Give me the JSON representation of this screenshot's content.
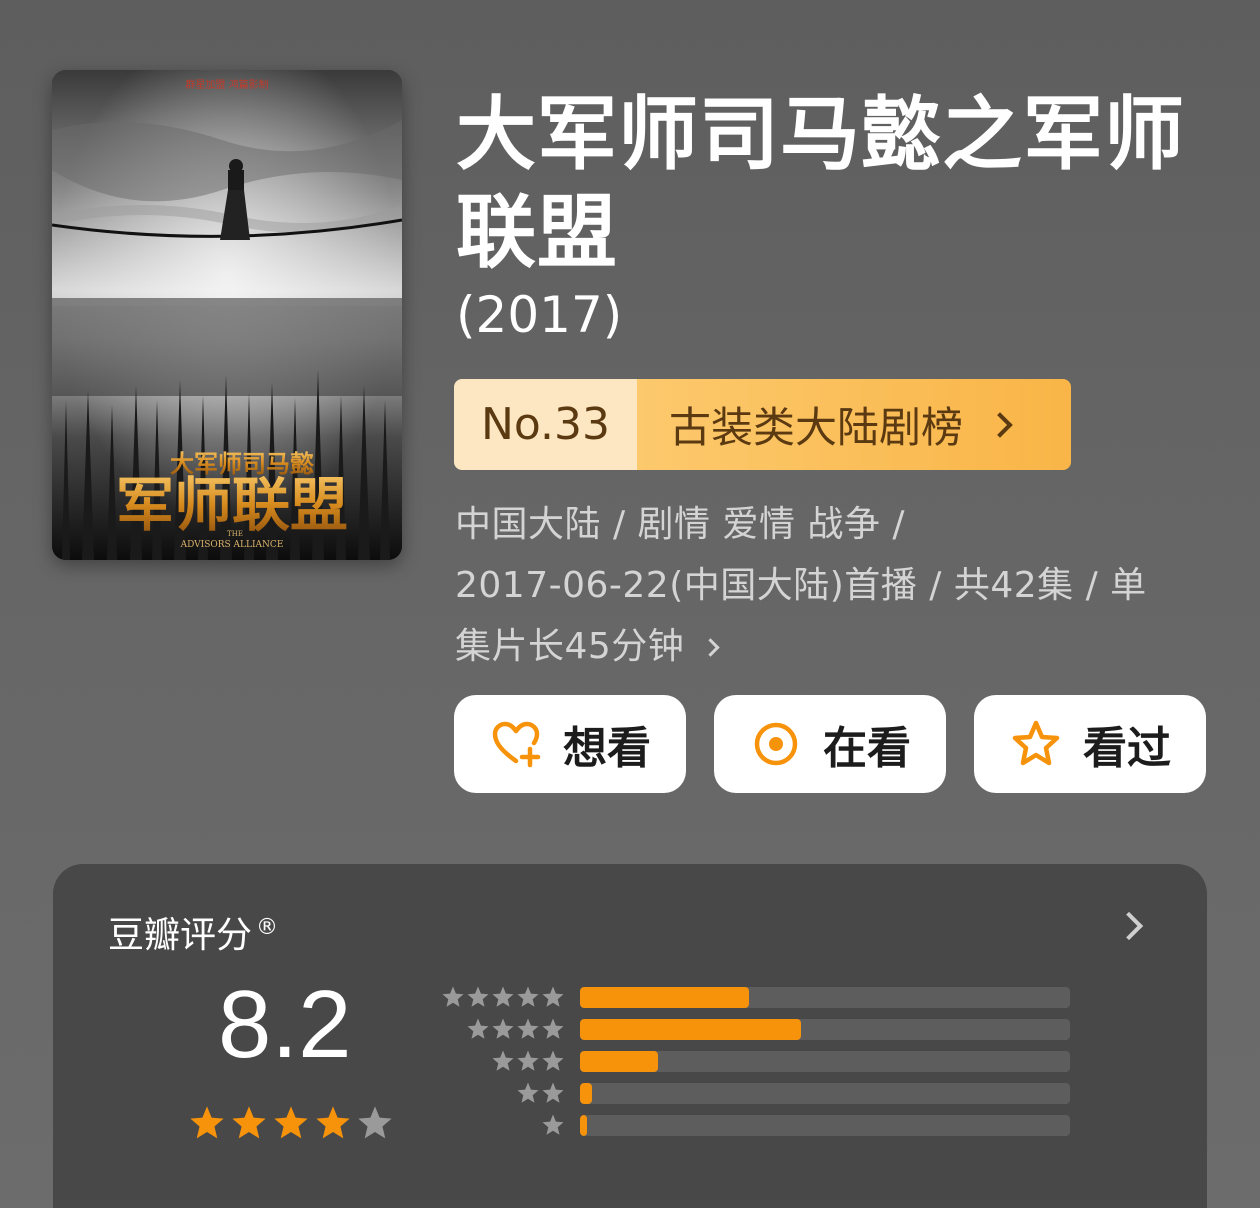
{
  "poster": {
    "top_text": "群星加盟  鸿篇影制",
    "title_small": "大军师司马懿",
    "title_big": "军师联盟",
    "subtitle_the": "THE",
    "subtitle_en": "ADVISORS ALLIANCE"
  },
  "title": "大军师司马懿之军师联盟",
  "year": "(2017)",
  "ranking": {
    "number": "No.33",
    "name": "古装类大陆剧榜"
  },
  "meta": {
    "line1": "中国大陆 / 剧情 爱情 战争 /",
    "line2": "2017-06-22(中国大陆)首播 / 共42集 / 单",
    "line3": "集片长45分钟"
  },
  "actions": {
    "want": "想看",
    "watching": "在看",
    "watched": "看过"
  },
  "rating": {
    "label": "豆瓣评分",
    "registered": "®",
    "score": "8.2",
    "stars_full": 4,
    "stars_total": 5,
    "distribution": [
      {
        "stars": 5,
        "fraction": 0.345
      },
      {
        "stars": 4,
        "fraction": 0.45
      },
      {
        "stars": 3,
        "fraction": 0.16
      },
      {
        "stars": 2,
        "fraction": 0.025
      },
      {
        "stars": 1,
        "fraction": 0.015
      }
    ]
  },
  "colors": {
    "accent": "#f7930b",
    "badge_light": "#fde7c2",
    "badge_dark": "#f9b547",
    "star_grey": "#9a9a9a"
  }
}
